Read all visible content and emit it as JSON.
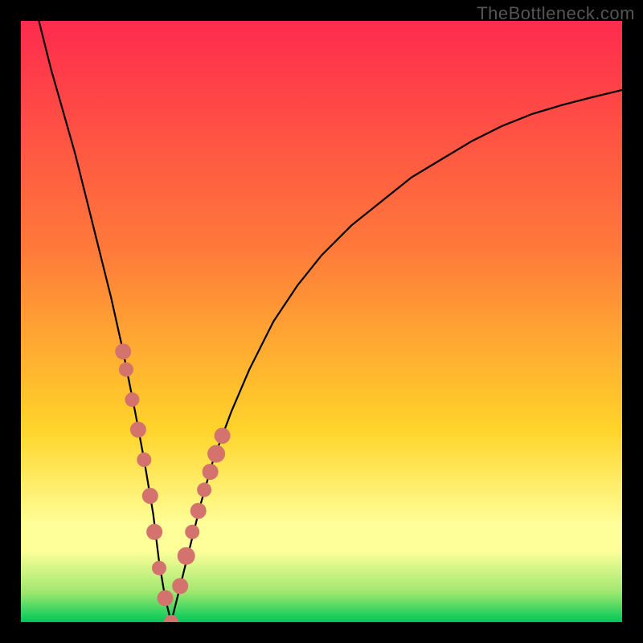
{
  "watermark": "TheBottleneck.com",
  "colors": {
    "black": "#000000",
    "curve": "#000000",
    "marker_fill": "#d4726e",
    "marker_stroke": "#c25a56",
    "grad_top": "#ff2b4e",
    "grad_mid1": "#ff7a3a",
    "grad_mid2": "#ffd42a",
    "grad_band": "#ffff9a",
    "grad_green1": "#9fe86f",
    "grad_green2": "#00c85a"
  },
  "chart_data": {
    "type": "line",
    "title": "",
    "xlabel": "",
    "ylabel": "",
    "xlim": [
      0,
      100
    ],
    "ylim": [
      0,
      100
    ],
    "series": [
      {
        "name": "bottleneck-curve",
        "x": [
          3,
          5,
          7,
          9,
          11,
          13,
          15,
          17,
          19,
          20.5,
          22,
          23,
          24,
          25,
          26,
          28,
          30,
          32,
          35,
          38,
          42,
          46,
          50,
          55,
          60,
          65,
          70,
          75,
          80,
          85,
          90,
          95,
          100
        ],
        "y": [
          100,
          92,
          85,
          78,
          70,
          62,
          54,
          45,
          35,
          27,
          18,
          10,
          4,
          0,
          4,
          12,
          20,
          27,
          35,
          42,
          50,
          56,
          61,
          66,
          70,
          74,
          77,
          80,
          82.5,
          84.5,
          86,
          87.3,
          88.5
        ]
      }
    ],
    "markers": {
      "name": "highlight-points",
      "x": [
        17.0,
        17.5,
        18.5,
        19.5,
        20.5,
        21.5,
        22.2,
        23.0,
        24.0,
        25.0,
        26.5,
        27.5,
        28.5,
        29.5,
        30.5,
        31.5,
        32.5,
        33.5
      ],
      "y": [
        45,
        42,
        37,
        32,
        27,
        21,
        15,
        9,
        4,
        0,
        6,
        11,
        15,
        18.5,
        22,
        25,
        28,
        31
      ],
      "r": [
        10,
        9,
        9,
        10,
        9,
        10,
        10,
        9,
        10,
        9,
        10,
        11,
        9,
        10,
        9,
        10,
        11,
        10
      ]
    }
  }
}
